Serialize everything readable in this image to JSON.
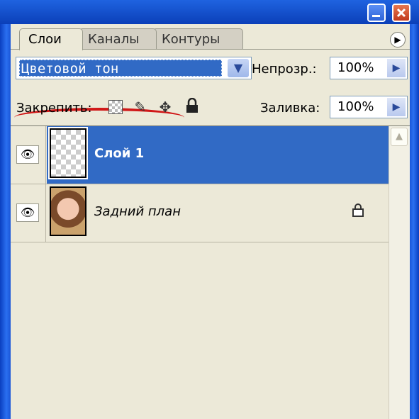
{
  "window": {
    "minimize_icon": "minimize-icon",
    "close_icon": "close-icon",
    "title_color": "#0b3fb8"
  },
  "tabs": [
    {
      "label": "Слои",
      "active": true
    },
    {
      "label": "Каналы",
      "active": false
    },
    {
      "label": "Контуры",
      "active": false
    }
  ],
  "panel_menu_icon": "flyout-menu-icon",
  "blend_mode": {
    "value": "Цветовой тон",
    "annotation": "red-underline"
  },
  "opacity": {
    "label": "Непрозр.:",
    "value": "100%"
  },
  "lock": {
    "label": "Закрепить:",
    "icons": [
      "lock-transparent-icon",
      "lock-brush-icon",
      "lock-move-icon",
      "lock-all-icon"
    ]
  },
  "fill": {
    "label": "Заливка:",
    "value": "100%"
  },
  "layers": [
    {
      "name": "Слой 1",
      "selected": true,
      "visible": true,
      "thumbnail": "transparent"
    },
    {
      "name": "Задний план",
      "selected": false,
      "visible": true,
      "thumbnail": "portrait",
      "locked": true
    }
  ],
  "colors": {
    "selection": "#316ac5",
    "panel_bg": "#ece9d8",
    "annotation": "#d01818"
  }
}
